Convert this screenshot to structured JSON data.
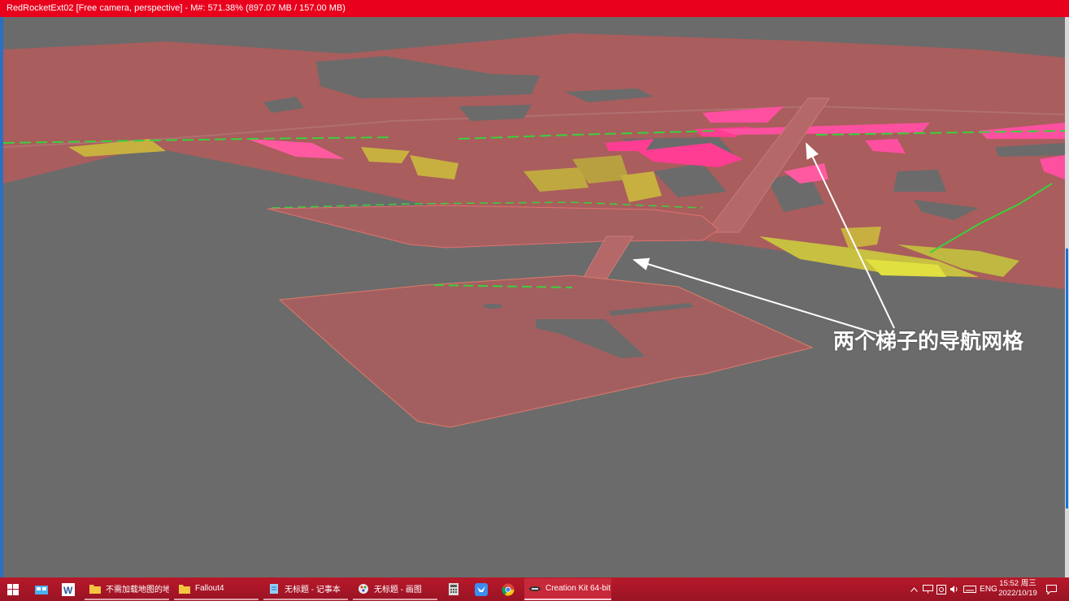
{
  "window": {
    "title": "RedRocketExt02 [Free camera, perspective] - M#: 571.38% (897.07 MB / 157.00 MB)"
  },
  "viewport": {
    "annotation": "两个梯子的导航网格",
    "colors": {
      "navmesh_red": "#b76262",
      "navmesh_pink": "#ff3d93",
      "navmesh_yellow": "#c8b040",
      "navmesh_green": "#3ccf3c",
      "background_gray": "#6b6b6b"
    }
  },
  "taskbar": {
    "start_icon": "windows-logo-icon",
    "pinned": [
      "file-explorer-icon",
      "word-icon"
    ],
    "apps": [
      {
        "label": "不需加载地图的地...",
        "icon": "folder-icon"
      },
      {
        "label": "Fallout4",
        "icon": "folder-icon"
      },
      {
        "label": "无标题 - 记事本",
        "icon": "notepad-icon"
      },
      {
        "label": "无标题 - 画图",
        "icon": "paint-icon"
      }
    ],
    "extra_icons": [
      "calculator-icon",
      "bird-app-icon",
      "chrome-icon"
    ],
    "active_app": {
      "label": "Creation Kit 64-bit",
      "icon": "creation-kit-icon"
    },
    "tray": {
      "language": "ENG",
      "time": "15:52 周三",
      "date": "2022/10/19"
    }
  }
}
